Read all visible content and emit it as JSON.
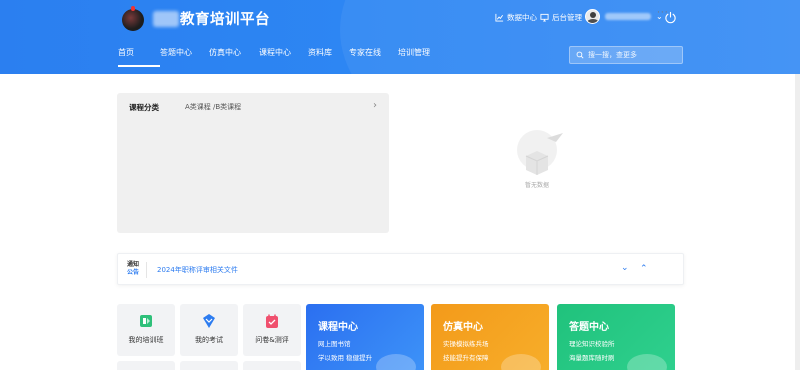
{
  "header": {
    "platform_title": "教育培训平台",
    "links": {
      "data_center": "数据中心",
      "backend_admin": "后台管理"
    },
    "nav": [
      {
        "label": "首页",
        "active": true
      },
      {
        "label": "答题中心"
      },
      {
        "label": "仿真中心"
      },
      {
        "label": "课程中心"
      },
      {
        "label": "资料库"
      },
      {
        "label": "专家在线"
      },
      {
        "label": "培训管理"
      }
    ],
    "search_placeholder": "搜一搜，查更多"
  },
  "course": {
    "category_label": "课程分类",
    "category_value": "A类课程 /B类课程"
  },
  "empty_state": {
    "text": "暂无数据"
  },
  "notice": {
    "badge_top": "通知",
    "badge_bottom": "公告",
    "text": "2024年职称评审相关文件",
    "more": "···"
  },
  "tiles": [
    {
      "label": "我的培训班",
      "icon": "training-class-icon",
      "color": "#2fc07a"
    },
    {
      "label": "我的考试",
      "icon": "exam-icon",
      "color": "#2d7cf0"
    },
    {
      "label": "问卷&测评",
      "icon": "survey-icon",
      "color": "#f0506e"
    }
  ],
  "cards": [
    {
      "title": "课程中心",
      "line1": "网上图书馆",
      "line2": "学以致用 稳健提升",
      "color": "#2b6ff0"
    },
    {
      "title": "仿真中心",
      "line1": "实操模拟练兵场",
      "line2": "技能提升有保障",
      "color": "#f39a1a"
    },
    {
      "title": "答题中心",
      "line1": "理论知识校验所",
      "line2": "海量题库随时刷",
      "color": "#20c27c"
    }
  ]
}
